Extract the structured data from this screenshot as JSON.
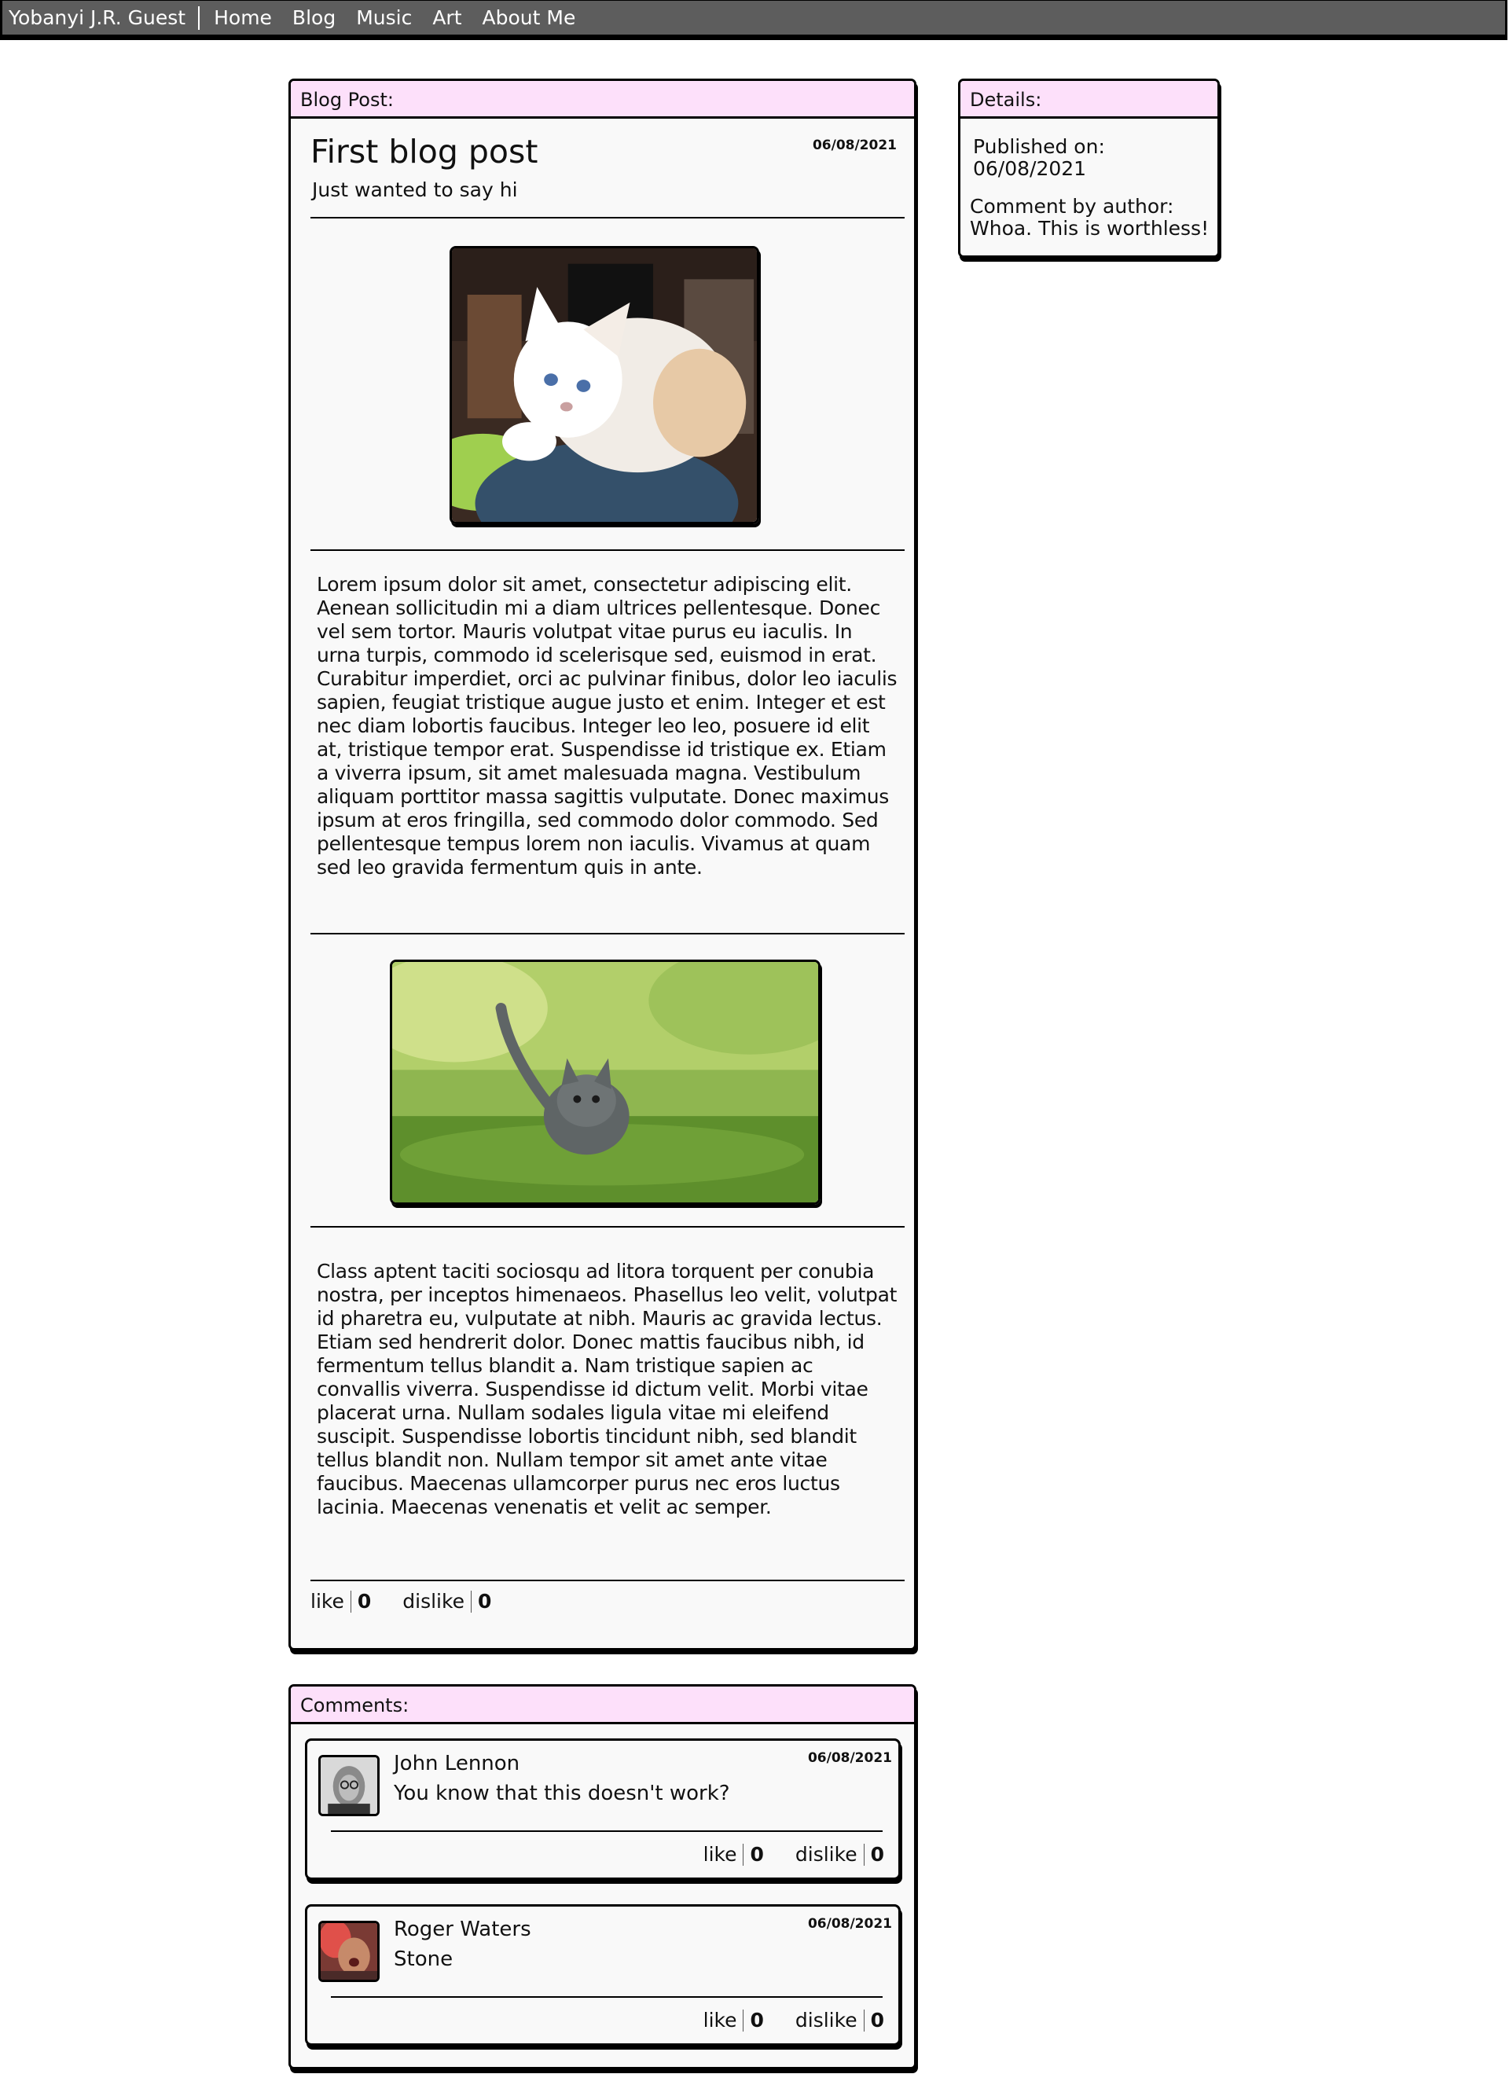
{
  "nav": {
    "brand": "Yobanyi J.R. Guest",
    "links": [
      "Home",
      "Blog",
      "Music",
      "Art",
      "About Me"
    ]
  },
  "post": {
    "header": "Blog Post:",
    "title": "First blog post",
    "subtitle": "Just wanted to say hi",
    "date": "06/08/2021",
    "paragraph1": "Lorem ipsum dolor sit amet, consectetur adipiscing elit. Aenean sollicitudin mi a diam ultrices pellentesque. Donec vel sem tortor. Mauris volutpat vitae purus eu iaculis. In urna turpis, commodo id scelerisque sed, euismod in erat. Curabitur imperdiet, orci ac pulvinar finibus, dolor leo iaculis sapien, feugiat tristique augue justo et enim. Integer et est nec diam lobortis faucibus. Integer leo leo, posuere id elit at, tristique tempor erat. Suspendisse id tristique ex. Etiam a viverra ipsum, sit amet malesuada magna. Vestibulum aliquam porttitor massa sagittis vulputate. Donec maximus ipsum at eros fringilla, sed commodo dolor commodo. Sed pellentesque tempus lorem non iaculis. Vivamus at quam sed leo gravida fermentum quis in ante.",
    "paragraph2": "Class aptent taciti sociosqu ad litora torquent per conubia nostra, per inceptos himenaeos. Phasellus leo velit, volutpat id pharetra eu, vulputate at nibh. Mauris ac gravida lectus. Etiam sed hendrerit dolor. Donec mattis faucibus nibh, id fermentum tellus blandit a. Nam tristique sapien ac convallis viverra. Suspendisse id dictum velit. Morbi vitae placerat urna. Nullam sodales ligula vitae mi eleifend suscipit. Suspendisse lobortis tincidunt nibh, sed blandit tellus blandit non. Nullam tempor sit amet ante vitae faucibus. Maecenas ullamcorper purus nec eros luctus lacinia. Maecenas venenatis et velit ac semper.",
    "like_label": "like",
    "like_count": "0",
    "dislike_label": "dislike",
    "dislike_count": "0"
  },
  "details": {
    "header": "Details:",
    "published_label": "Published on:",
    "published_date": "06/08/2021",
    "comment_label": "Comment by author:",
    "comment_text": "Whoa. This is worthless!"
  },
  "comments": {
    "header": "Comments:",
    "items": [
      {
        "author": "John Lennon",
        "text": "You know that this doesn't work?",
        "date": "06/08/2021",
        "like_label": "like",
        "like_count": "0",
        "dislike_label": "dislike",
        "dislike_count": "0"
      },
      {
        "author": "Roger Waters",
        "text": "Stone",
        "date": "06/08/2021",
        "like_label": "like",
        "like_count": "0",
        "dislike_label": "dislike",
        "dislike_count": "0"
      }
    ]
  },
  "colors": {
    "nav_bg": "#5d5d5d",
    "panel_header_bg": "#fde0fa",
    "panel_bg": "#f9f9f9"
  }
}
